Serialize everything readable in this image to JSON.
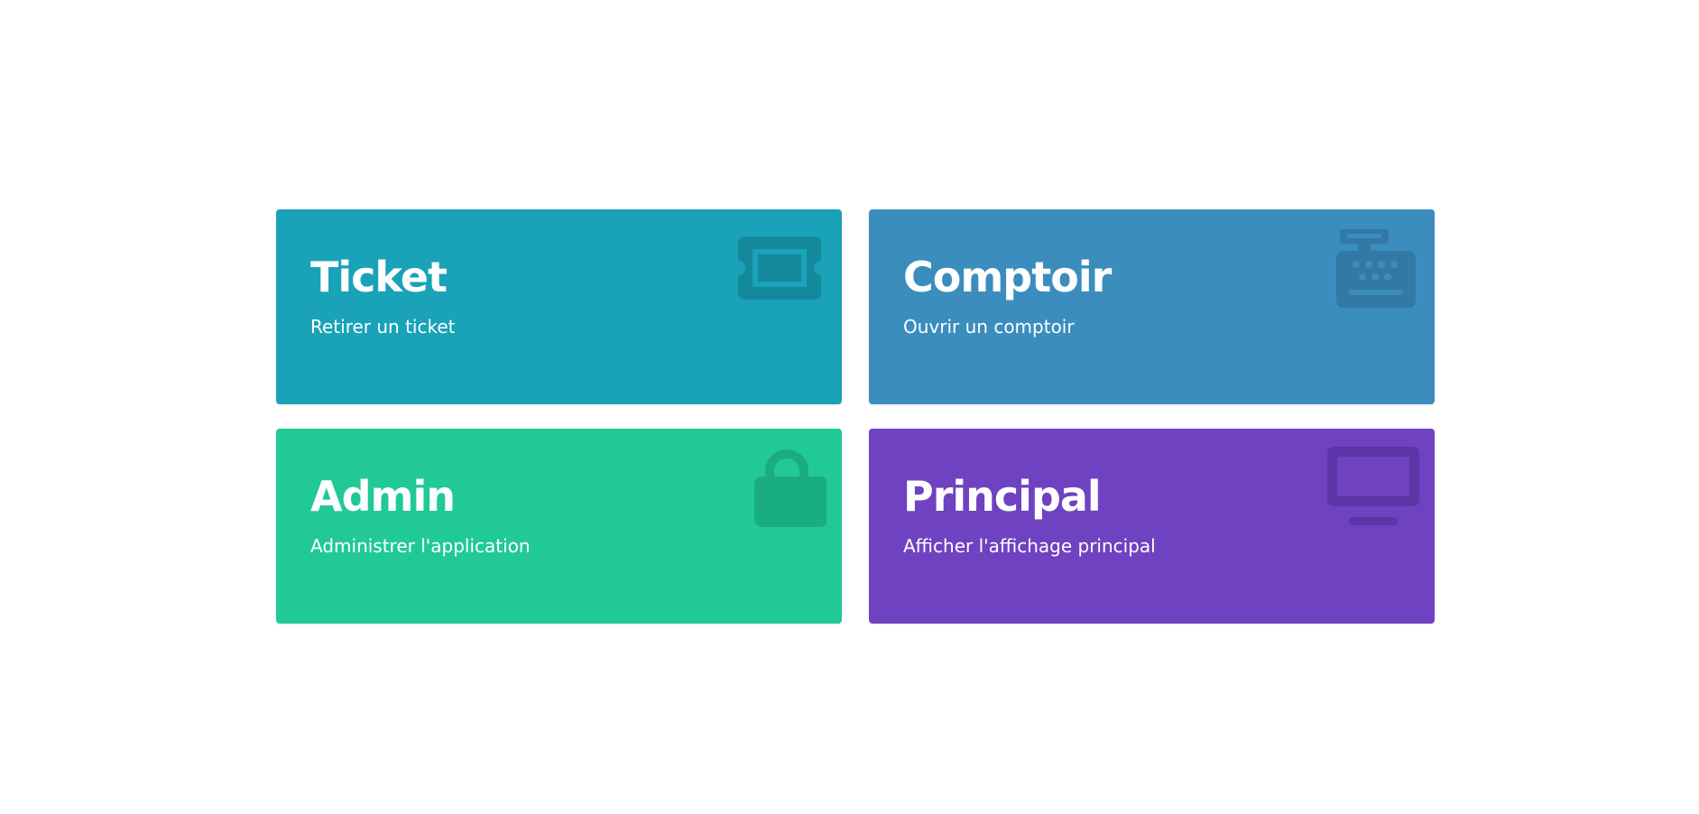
{
  "cards": [
    {
      "title": "Ticket",
      "description": "Retirer un ticket",
      "icon": "ticket-icon",
      "color": "#19a2b8",
      "icon_color": "#14899c"
    },
    {
      "title": "Comptoir",
      "description": "Ouvrir un comptoir",
      "icon": "cash-register-icon",
      "color": "#3b8dbd",
      "icon_color": "#3379a5"
    },
    {
      "title": "Admin",
      "description": "Administrer l'application",
      "icon": "lock-icon",
      "color": "#21c997",
      "icon_color": "#1aad80"
    },
    {
      "title": "Principal",
      "description": "Afficher l'affichage principal",
      "icon": "monitor-icon",
      "color": "#6f42c1",
      "icon_color": "#5c35a6"
    }
  ]
}
